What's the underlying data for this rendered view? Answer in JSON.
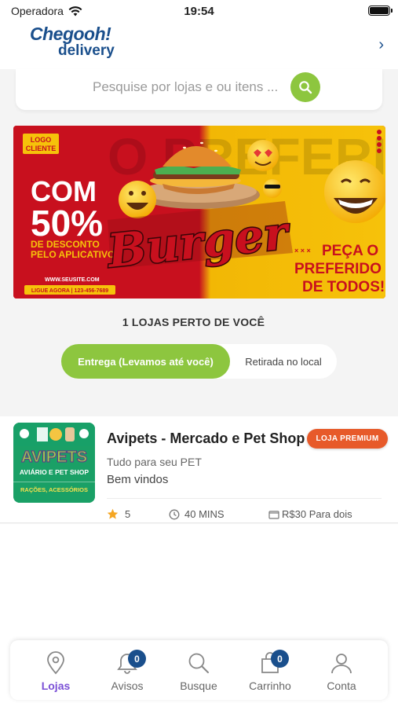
{
  "status_bar": {
    "carrier": "Operadora",
    "time": "19:54"
  },
  "header": {
    "logo_line1": "Chegooh!",
    "logo_line2": "delivery"
  },
  "search": {
    "placeholder": "Pesquise por lojas e ou itens ..."
  },
  "banner": {
    "logo_badge_line1": "LOGO",
    "logo_badge_line2": "CLIENTE",
    "discount_line1": "COM",
    "discount_line2": "50%",
    "discount_line3": "DE DESCONTO",
    "discount_line4": "PELO APLICATIVO",
    "website": "WWW.SEUSITE.COM",
    "phone": "LIGUE AGORA | 123-456-7689",
    "title": "Burger",
    "tagline1": "PEÇA O",
    "tagline2": "PREFERIDO",
    "tagline3": "DE TODOS!",
    "bg_text": "O PREFERIDO"
  },
  "stores": {
    "count_label": "1 LOJAS PERTO DE VOCÊ",
    "toggle_delivery": "Entrega (Levamos até você)",
    "toggle_pickup": "Retirada no local",
    "items": [
      {
        "name": "Avipets - Mercado e Pet Shop",
        "badge": "LOJA PREMIUM",
        "description": "Tudo para seu PET",
        "welcome": "Bem vindos",
        "rating": "5",
        "time": "40 MINS",
        "price": "R$30 Para dois",
        "logo_title": "AVIPETS",
        "logo_sub1": "AVIÁRIO E PET SHOP",
        "logo_sub2": "RAÇÕES, ACESSÓRIOS"
      }
    ]
  },
  "tabbar": {
    "tabs": [
      {
        "label": "Lojas",
        "icon": "location-pin-icon",
        "active": true
      },
      {
        "label": "Avisos",
        "icon": "bell-icon",
        "badge": "0"
      },
      {
        "label": "Busque",
        "icon": "search-icon"
      },
      {
        "label": "Carrinho",
        "icon": "cart-icon",
        "badge": "0"
      },
      {
        "label": "Conta",
        "icon": "user-icon"
      }
    ]
  },
  "colors": {
    "brand_blue": "#1a4f8c",
    "accent_green": "#8dc63f",
    "premium_orange": "#e75a2a",
    "active_purple": "#7a4fd6"
  }
}
